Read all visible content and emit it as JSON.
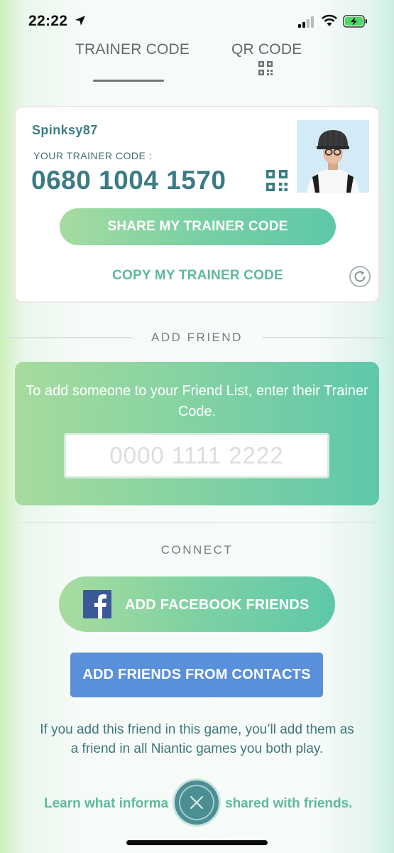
{
  "status_bar": {
    "time": "22:22",
    "icons": [
      "location-arrow-icon",
      "cellular-signal-icon",
      "wifi-icon",
      "battery-charging-icon"
    ]
  },
  "tabs": [
    {
      "label": "TRAINER CODE",
      "selected": true
    },
    {
      "label": "QR CODE",
      "selected": false,
      "icon": "qr-code-icon"
    }
  ],
  "trainer_card": {
    "username": "Spinksy87",
    "code_label": "YOUR TRAINER CODE :",
    "code": "0680 1004 1570",
    "share_button": "SHARE MY TRAINER CODE",
    "copy_button": "COPY MY TRAINER CODE"
  },
  "add_friend": {
    "title": "ADD FRIEND",
    "instructions": "To add someone to your Friend List, enter their Trainer Code.",
    "input_placeholder": "0000 1111 2222",
    "input_value": ""
  },
  "connect": {
    "title": "CONNECT",
    "facebook_button": "ADD FACEBOOK FRIENDS",
    "contacts_button": "ADD FRIENDS FROM CONTACTS",
    "info": "If you add this friend in this game, you’ll add them as a friend in all Niantic games you both play.",
    "learn_more_left": "Learn what informa",
    "learn_more_right": "shared with friends."
  },
  "colors": {
    "accent_teal": "#3b7b84",
    "button_green_start": "#a6dba0",
    "button_green_end": "#5ec8a9",
    "contacts_blue": "#5a8fdb",
    "facebook_blue": "#3b5998"
  }
}
